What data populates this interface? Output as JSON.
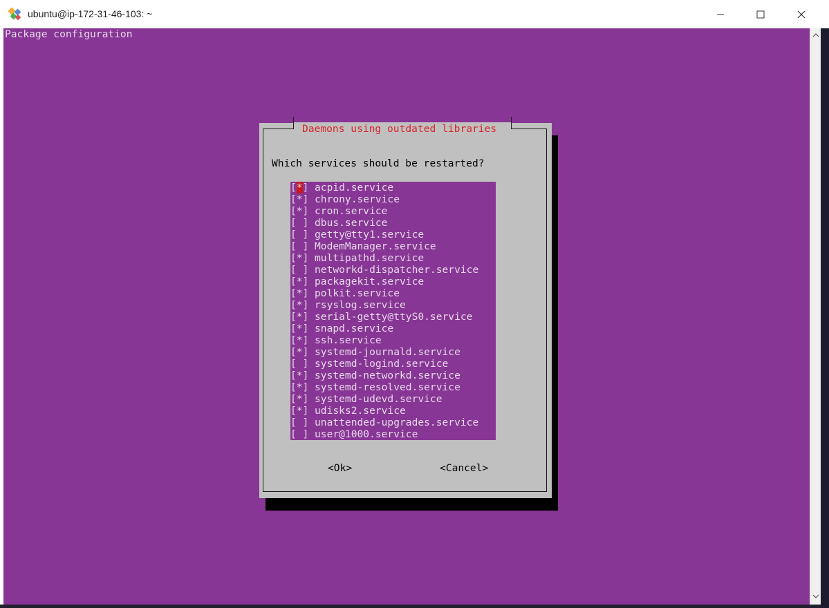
{
  "window": {
    "title": "ubuntu@ip-172-31-46-103: ~",
    "icon": "putty-icon"
  },
  "terminal": {
    "header": "Package configuration"
  },
  "dialog": {
    "title": "Daemons using outdated libraries",
    "question": "Which services should be restarted?",
    "services": [
      {
        "mark": "[*]",
        "name": "acpid.service"
      },
      {
        "mark": "[*]",
        "name": "chrony.service"
      },
      {
        "mark": "[*]",
        "name": "cron.service"
      },
      {
        "mark": "[ ]",
        "name": "dbus.service"
      },
      {
        "mark": "[ ]",
        "name": "getty@tty1.service"
      },
      {
        "mark": "[ ]",
        "name": "ModemManager.service"
      },
      {
        "mark": "[*]",
        "name": "multipathd.service"
      },
      {
        "mark": "[ ]",
        "name": "networkd-dispatcher.service"
      },
      {
        "mark": "[*]",
        "name": "packagekit.service"
      },
      {
        "mark": "[*]",
        "name": "polkit.service"
      },
      {
        "mark": "[*]",
        "name": "rsyslog.service"
      },
      {
        "mark": "[*]",
        "name": "serial-getty@ttyS0.service"
      },
      {
        "mark": "[*]",
        "name": "snapd.service"
      },
      {
        "mark": "[*]",
        "name": "ssh.service"
      },
      {
        "mark": "[*]",
        "name": "systemd-journald.service"
      },
      {
        "mark": "[ ]",
        "name": "systemd-logind.service"
      },
      {
        "mark": "[*]",
        "name": "systemd-networkd.service"
      },
      {
        "mark": "[*]",
        "name": "systemd-resolved.service"
      },
      {
        "mark": "[*]",
        "name": "systemd-udevd.service"
      },
      {
        "mark": "[*]",
        "name": "udisks2.service"
      },
      {
        "mark": "[ ]",
        "name": "unattended-upgrades.service"
      },
      {
        "mark": "[ ]",
        "name": "user@1000.service"
      }
    ],
    "ok_label": "<Ok>",
    "cancel_label": "<Cancel>"
  },
  "colors": {
    "terminal_bg": "#883695",
    "dialog_bg": "#c0c0c0",
    "title_red": "#d8232a",
    "cursor_red": "#c9191c",
    "list_text": "#e6d8ea"
  }
}
